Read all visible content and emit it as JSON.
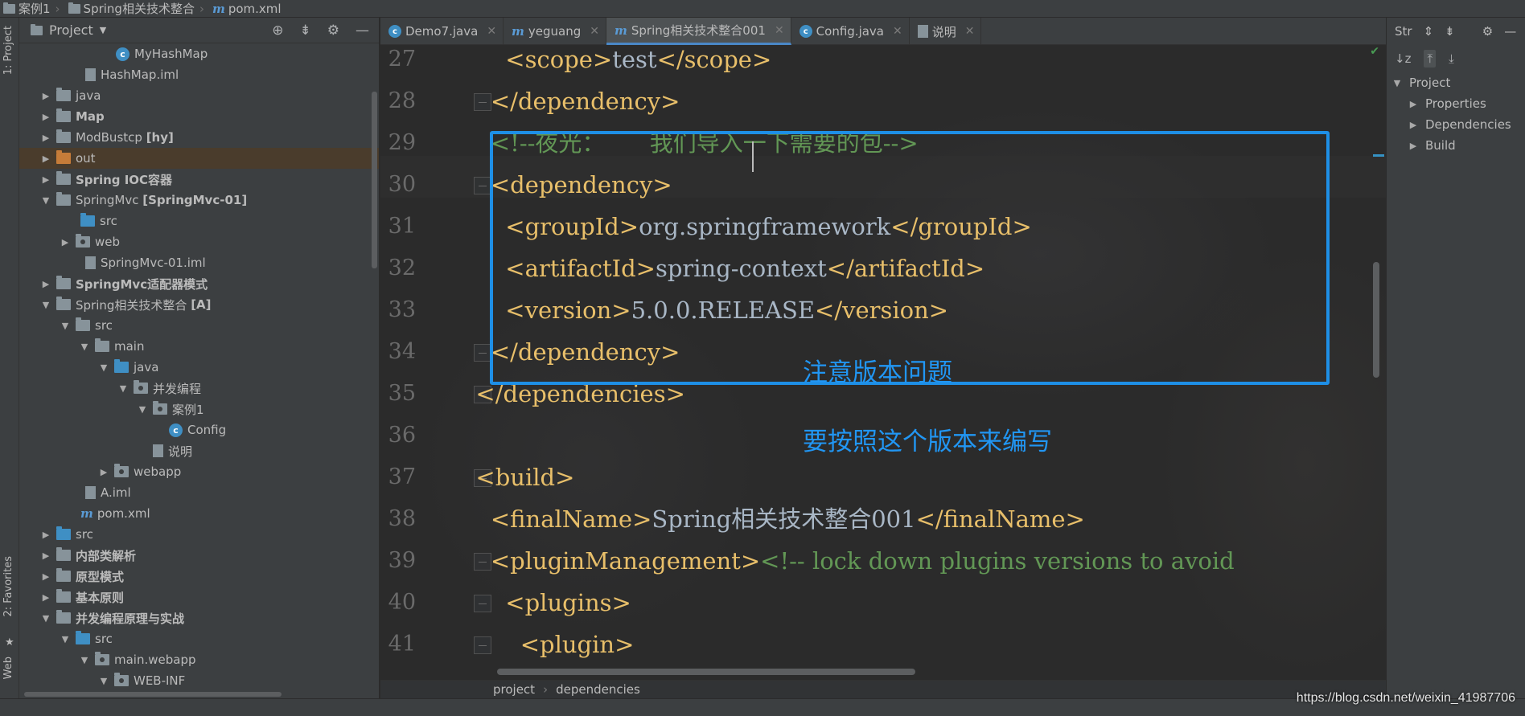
{
  "navbar": {
    "crumbs": [
      "案例1",
      "Spring相关技术整合",
      "pom.xml"
    ]
  },
  "left_strip": {
    "project_label": "1: Project",
    "favorites_label": "2: Favorites",
    "web_label": "Web"
  },
  "project": {
    "title": "Project",
    "items": [
      {
        "label": "MyHashMap",
        "bold_suffix": ""
      },
      {
        "label": "HashMap.iml",
        "bold_suffix": ""
      },
      {
        "label": "java",
        "bold_suffix": ""
      },
      {
        "label": "Map",
        "bold_suffix": ""
      },
      {
        "label": "ModBustcp",
        "bold_suffix": "[hy]"
      },
      {
        "label": "out",
        "bold_suffix": ""
      },
      {
        "label": "Spring IOC容器",
        "bold_suffix": ""
      },
      {
        "label": "SpringMvc",
        "bold_suffix": "[SpringMvc-01]"
      },
      {
        "label": "src",
        "bold_suffix": ""
      },
      {
        "label": "web",
        "bold_suffix": ""
      },
      {
        "label": "SpringMvc-01.iml",
        "bold_suffix": ""
      },
      {
        "label": "SpringMvc适配器模式",
        "bold_suffix": ""
      },
      {
        "label": "Spring相关技术整合",
        "bold_suffix": "[A]"
      },
      {
        "label": "src",
        "bold_suffix": ""
      },
      {
        "label": "main",
        "bold_suffix": ""
      },
      {
        "label": "java",
        "bold_suffix": ""
      },
      {
        "label": "并发编程",
        "bold_suffix": ""
      },
      {
        "label": "案例1",
        "bold_suffix": ""
      },
      {
        "label": "Config",
        "bold_suffix": ""
      },
      {
        "label": "说明",
        "bold_suffix": ""
      },
      {
        "label": "webapp",
        "bold_suffix": ""
      },
      {
        "label": "A.iml",
        "bold_suffix": ""
      },
      {
        "label": "pom.xml",
        "bold_suffix": ""
      },
      {
        "label": "src",
        "bold_suffix": ""
      },
      {
        "label": "内部类解析",
        "bold_suffix": ""
      },
      {
        "label": "原型模式",
        "bold_suffix": ""
      },
      {
        "label": "基本原则",
        "bold_suffix": ""
      },
      {
        "label": "并发编程原理与实战",
        "bold_suffix": ""
      },
      {
        "label": "src",
        "bold_suffix": ""
      },
      {
        "label": "main.webapp",
        "bold_suffix": ""
      },
      {
        "label": "WEB-INF",
        "bold_suffix": ""
      }
    ]
  },
  "tabs": [
    {
      "label": "Demo7.java",
      "icon": "class-icon"
    },
    {
      "label": "yeguang",
      "icon": "maven-icon"
    },
    {
      "label": "Spring相关技术整合001",
      "icon": "maven-icon",
      "active": true
    },
    {
      "label": "Config.java",
      "icon": "class-icon"
    },
    {
      "label": "说明",
      "icon": "text-file-icon"
    }
  ],
  "editor": {
    "lines": [
      {
        "num": "27",
        "parts": [
          [
            "tag",
            "      <scope>"
          ],
          [
            "txt",
            "test"
          ],
          [
            "tag",
            "</scope>"
          ]
        ]
      },
      {
        "num": "28",
        "parts": [
          [
            "tag",
            "    </dependency>"
          ]
        ]
      },
      {
        "num": "29",
        "parts": [
          [
            "cmt",
            "    <!--夜光：      我们导入一下需要的包-->"
          ]
        ]
      },
      {
        "num": "30",
        "parts": [
          [
            "tag",
            "    <dependency>"
          ]
        ]
      },
      {
        "num": "31",
        "parts": [
          [
            "tag",
            "      <groupId>"
          ],
          [
            "txt",
            "org.springframework"
          ],
          [
            "tag",
            "</groupId>"
          ]
        ]
      },
      {
        "num": "32",
        "parts": [
          [
            "tag",
            "      <artifactId>"
          ],
          [
            "txt",
            "spring-context"
          ],
          [
            "tag",
            "</artifactId>"
          ]
        ]
      },
      {
        "num": "33",
        "parts": [
          [
            "tag",
            "      <version>"
          ],
          [
            "txt",
            "5.0.0.RELEASE"
          ],
          [
            "tag",
            "</version>"
          ]
        ]
      },
      {
        "num": "34",
        "parts": [
          [
            "tag",
            "    </dependency>"
          ]
        ]
      },
      {
        "num": "35",
        "parts": [
          [
            "tag",
            "  </dependencies>"
          ]
        ]
      },
      {
        "num": "36",
        "parts": []
      },
      {
        "num": "37",
        "parts": [
          [
            "tag",
            "  <build>"
          ]
        ]
      },
      {
        "num": "38",
        "parts": [
          [
            "tag",
            "    <finalName>"
          ],
          [
            "txt",
            "Spring相关技术整合001"
          ],
          [
            "tag",
            "</finalName>"
          ]
        ]
      },
      {
        "num": "39",
        "parts": [
          [
            "tag",
            "    <pluginManagement>"
          ],
          [
            "cmt",
            "<!-- lock down plugins versions to avoid"
          ]
        ]
      },
      {
        "num": "40",
        "parts": [
          [
            "tag",
            "      <plugins>"
          ]
        ]
      },
      {
        "num": "41",
        "parts": [
          [
            "tag",
            "        <plugin>"
          ]
        ]
      }
    ],
    "annotation_1": "注意版本问题",
    "annotation_2": "要按照这个版本来编写"
  },
  "editor_breadcrumb": [
    "project",
    "dependencies"
  ],
  "structure": {
    "title": "Str",
    "root": "Project",
    "children": [
      "Properties",
      "Dependencies",
      "Build"
    ]
  },
  "watermark": "https://blog.csdn.net/weixin_41987706",
  "colors": {
    "accent": "#1e8fe6",
    "tag": "#e8bf6a",
    "text": "#a9b7c6",
    "comment": "#629755"
  }
}
